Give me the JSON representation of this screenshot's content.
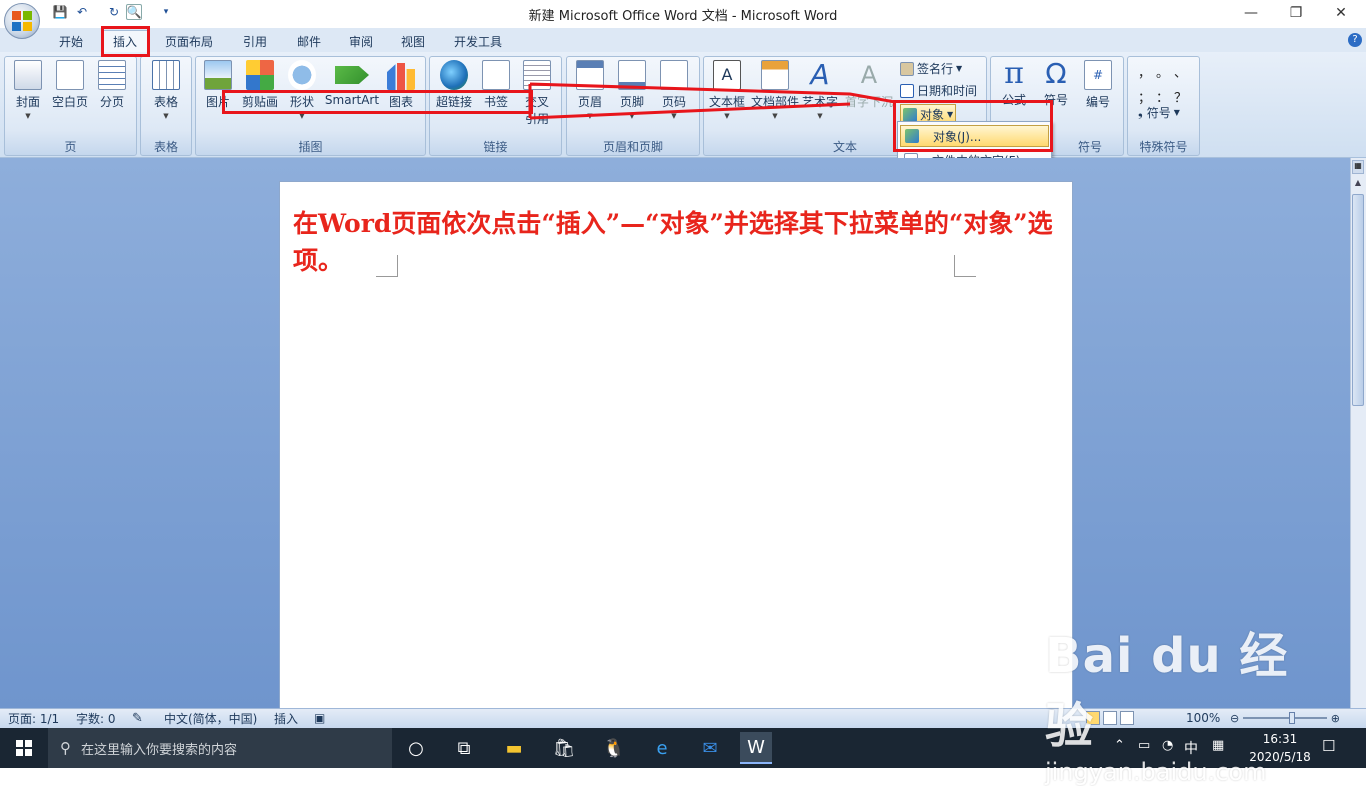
{
  "window": {
    "title": "新建 Microsoft Office Word 文档 - Microsoft Word",
    "controls": {
      "minimize": "—",
      "restore": "❐",
      "close": "✕"
    }
  },
  "quick_access": [
    "save-icon",
    "undo-icon",
    "redo-icon",
    "print-preview-icon",
    "customize-arrow-icon"
  ],
  "tabs": [
    {
      "label": "开始",
      "active": false
    },
    {
      "label": "插入",
      "active": true
    },
    {
      "label": "页面布局",
      "active": false
    },
    {
      "label": "引用",
      "active": false
    },
    {
      "label": "邮件",
      "active": false
    },
    {
      "label": "审阅",
      "active": false
    },
    {
      "label": "视图",
      "active": false
    },
    {
      "label": "开发工具",
      "active": false
    }
  ],
  "ribbon": {
    "page_group": {
      "label": "页",
      "buttons": [
        "封面",
        "空白页",
        "分页"
      ]
    },
    "table_group": {
      "label": "表格",
      "buttons": [
        "表格"
      ]
    },
    "illustration_group": {
      "label": "插图",
      "buttons": [
        "图片",
        "剪贴画",
        "形状",
        "SmartArt",
        "图表"
      ]
    },
    "link_group": {
      "label": "链接",
      "buttons": [
        "超链接",
        "书签",
        "交叉",
        "引用"
      ]
    },
    "header_group": {
      "label": "页眉和页脚",
      "buttons": [
        "页眉",
        "页脚",
        "页码"
      ]
    },
    "text_group": {
      "label": "文本",
      "buttons": [
        "文本框",
        "文档部件",
        "艺术字",
        "首字下沉"
      ],
      "small": [
        "签名行",
        "日期和时间",
        "对象"
      ]
    },
    "symbol_group": {
      "label": "符号",
      "buttons": [
        "公式",
        "符号",
        "编号"
      ]
    },
    "special_group": {
      "label": "特殊符号",
      "marks": [
        "，",
        "。",
        "、",
        "；",
        "：",
        "？"
      ],
      "button": "符号"
    }
  },
  "dropdown": {
    "items": [
      "对象(J)...",
      "文件中的文字(F)..."
    ]
  },
  "document": {
    "instruction": "在Word页面依次点击“插入”—“对象”并选择其下拉菜单的“对象”选项。"
  },
  "statusbar": {
    "page": "页面: 1/1",
    "words": "字数: 0",
    "language": "中文(简体，中国)",
    "mode": "插入",
    "zoom": "100%"
  },
  "taskbar": {
    "search_placeholder": "在这里输入你要搜索的内容",
    "time": "16:31",
    "date": "2020/5/18",
    "ime": "中"
  },
  "watermark": {
    "brand": "Bai du 经验",
    "url": "jingyan.baidu.com"
  },
  "colors": {
    "accent": "#e8151b",
    "ribbon": "#dde8f5",
    "workspace": "#7a9fd4"
  }
}
